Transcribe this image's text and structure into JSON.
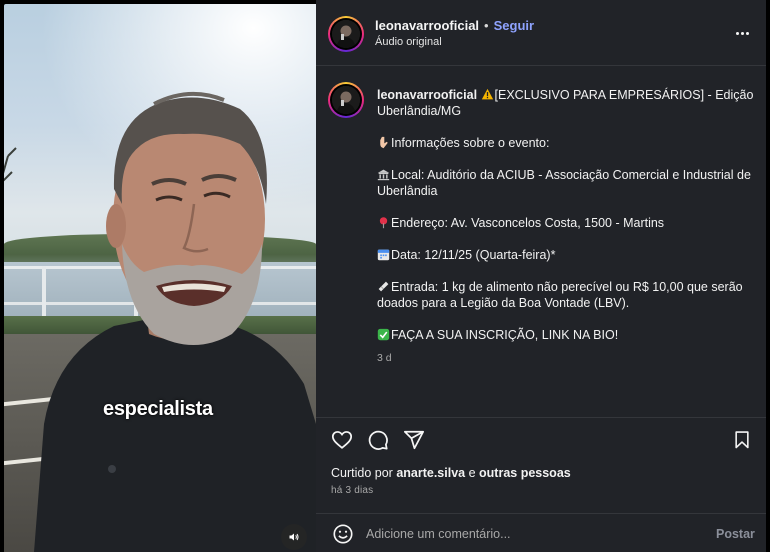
{
  "video": {
    "caption_word": "especialista",
    "mute_icon": "speaker-icon"
  },
  "header": {
    "username": "leonavarrooficial",
    "separator": "•",
    "follow_label": "Seguir",
    "audio_label": "Áudio original",
    "more_icon": "more-horizontal-icon"
  },
  "caption": {
    "username": "leonavarrooficial",
    "headline": "[EXCLUSIVO PARA EMPRESÁRIOS] - Edição Uberlândia/MG",
    "info_intro": "Informações sobre o evento:",
    "local": "Local: Auditório da ACIUB - Associação Comercial e Industrial de Uberlândia",
    "endereco": "Endereço: Av. Vasconcelos Costa, 1500 - Martins",
    "data": "Data: 12/11/25 (Quarta-feira)*",
    "entrada": "Entrada: 1 kg de alimento não perecível ou R$ 10,00 que serão doados para a Legião da Boa Vontade (LBV).",
    "cta": "FAÇA A SUA INSCRIÇÃO, LINK NA BIO!",
    "age": "3 d"
  },
  "actions": {
    "like_icon": "heart-icon",
    "comment_icon": "comment-icon",
    "share_icon": "send-icon",
    "save_icon": "bookmark-icon"
  },
  "likes": {
    "prefix": "Curtido por ",
    "user": "anarte.silva",
    "middle": " e ",
    "others": "outras pessoas",
    "time_ago": "há 3 dias"
  },
  "comment": {
    "placeholder": "Adicione um comentário...",
    "post_label": "Postar",
    "emoji_icon": "smiley-icon"
  },
  "colors": {
    "panel_bg": "#212328",
    "link_blue": "#8fa3ff",
    "muted_text": "#a8a8a8"
  }
}
